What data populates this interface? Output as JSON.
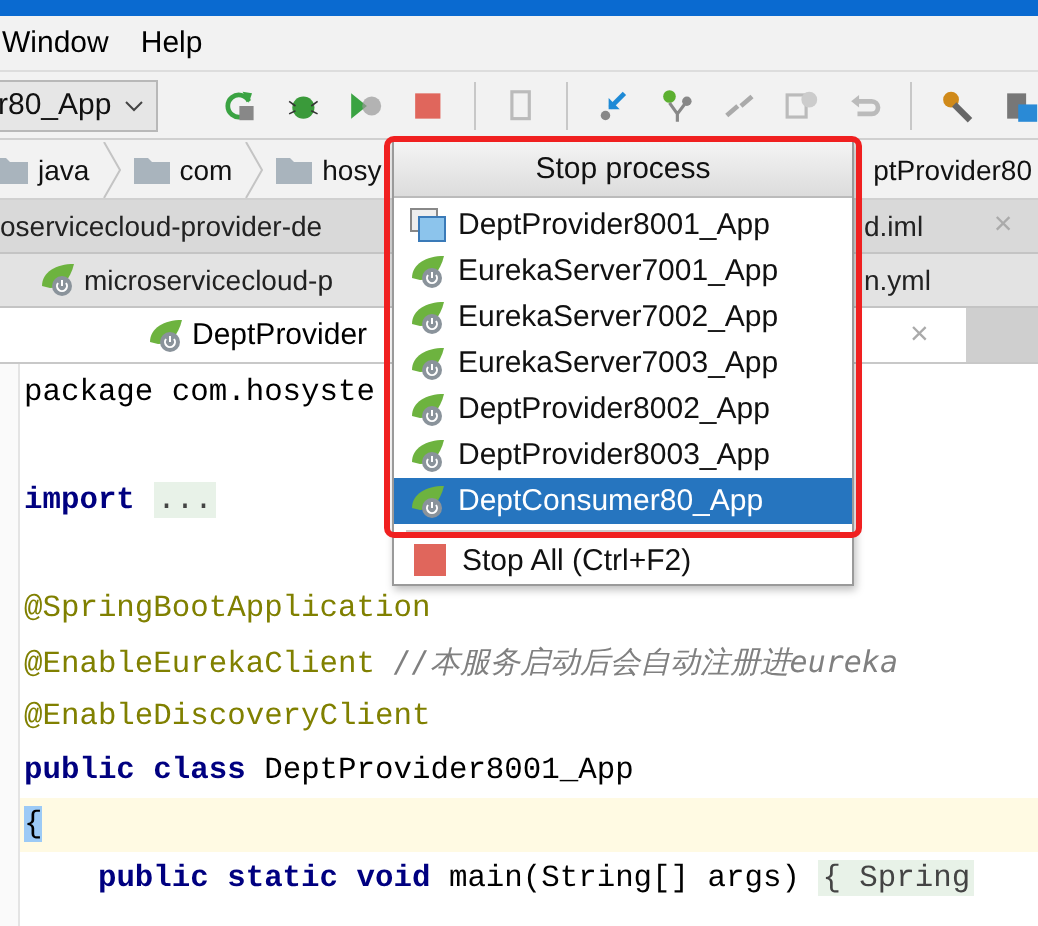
{
  "menu_bar": {
    "items": [
      "Window",
      "Help"
    ]
  },
  "toolbar": {
    "run_config": "r80_App"
  },
  "breadcrumb": {
    "items": [
      "java",
      "com",
      "hosy"
    ],
    "trailing": "ptProvider80"
  },
  "file_tabs": [
    {
      "kind": "plain",
      "left": "oservicecloud-provider-de",
      "right": "d.iml",
      "close": "×"
    },
    {
      "kind": "spring",
      "left": "microservicecloud-p",
      "right": "n.yml"
    }
  ],
  "editor_tab": {
    "label": "DeptProvider",
    "selected": true,
    "close": "×"
  },
  "code": [
    {
      "kind": "package",
      "text": "package com.hosyste"
    },
    {
      "kind": "blank"
    },
    {
      "kind": "import",
      "keyword": "import",
      "text": "..."
    },
    {
      "kind": "blank"
    },
    {
      "kind": "annotation",
      "text": "@SpringBootApplication"
    },
    {
      "kind": "annotation",
      "text": "@EnableEurekaClient",
      "comment": "//本服务启动后会自动注册进eureka"
    },
    {
      "kind": "annotation",
      "text": "@EnableDiscoveryClient"
    },
    {
      "kind": "class",
      "keywords": "public class",
      "text": "DeptProvider8001_App"
    },
    {
      "kind": "brace",
      "text": "{"
    },
    {
      "kind": "method",
      "keywords": "public static void",
      "text": "main(String[] args)",
      "tail": "{ Spring"
    }
  ],
  "popup": {
    "title": "Stop process",
    "items": [
      {
        "label": "DeptProvider8001_App",
        "kind": "window",
        "selected": false
      },
      {
        "label": "EurekaServer7001_App",
        "kind": "spring",
        "selected": false
      },
      {
        "label": "EurekaServer7002_App",
        "kind": "spring",
        "selected": false
      },
      {
        "label": "EurekaServer7003_App",
        "kind": "spring",
        "selected": false
      },
      {
        "label": "DeptProvider8002_App",
        "kind": "spring",
        "selected": false
      },
      {
        "label": "DeptProvider8003_App",
        "kind": "spring",
        "selected": false
      },
      {
        "label": "DeptConsumer80_App",
        "kind": "spring",
        "selected": true
      }
    ],
    "stop_all": "Stop All (Ctrl+F2)"
  }
}
